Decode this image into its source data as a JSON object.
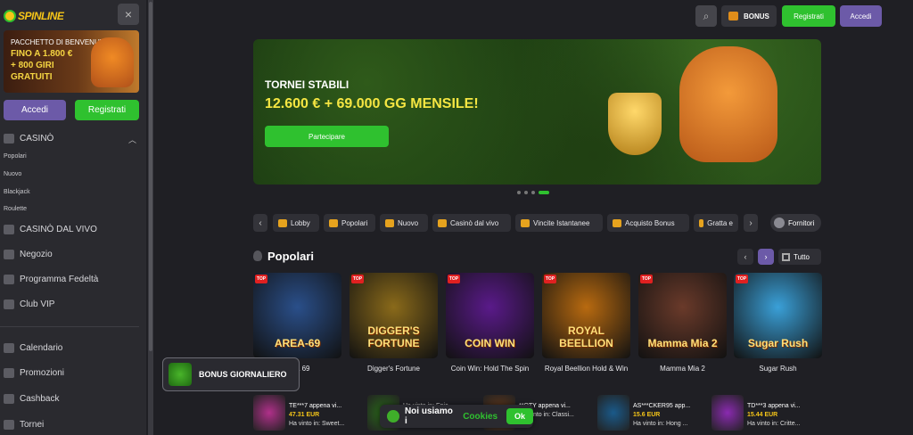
{
  "sidebar": {
    "logo_text": "SPINLINE",
    "close_icon": "×",
    "promo": {
      "line1": "PACCHETTO DI BENVENUTO",
      "line2": "FINO A 1.800 €",
      "line3": "+ 800 GIRI",
      "line4": "GRATUITI"
    },
    "accedi_label": "Accedi",
    "registrati_label": "Registrati",
    "casino_label": "CASINÒ",
    "casino_sub": [
      "Popolari",
      "Nuovo",
      "Blackjack",
      "Roulette"
    ],
    "menu": [
      "CASINÒ DAL VIVO",
      "Negozio",
      "Programma Fedeltà",
      "Club VIP"
    ],
    "menu2": [
      "Calendario",
      "Promozioni",
      "Cashback",
      "Tornei"
    ]
  },
  "topbar": {
    "search_icon": "search-icon",
    "bonus_label": "BONUS",
    "registrati_label": "Registrati",
    "accedi_label": "Accedi"
  },
  "banner": {
    "title": "TORNEI STABILI",
    "subtitle": "12.600 € + 69.000 GG MENSILE!",
    "button": "Partecipare"
  },
  "categories": [
    "Lobby",
    "Popolari",
    "Nuovo",
    "Casinò dal vivo",
    "Vincite Istantanee",
    "Acquisto Bonus",
    "Gratta e"
  ],
  "fornitori_label": "Fornitori",
  "section": {
    "title": "Popolari",
    "tutto_label": "Tutto"
  },
  "games": [
    {
      "name": "Area 69",
      "art": "AREA-69",
      "badge": "TOP",
      "color": "#2a4f8a"
    },
    {
      "name": "Digger's Fortune",
      "art": "DIGGER'S FORTUNE",
      "badge": "TOP",
      "color": "#8a6a1a"
    },
    {
      "name": "Coin Win: Hold The Spin",
      "art": "COIN WIN",
      "badge": "TOP",
      "color": "#5a1a8a"
    },
    {
      "name": "Royal Beellion Hold & Win",
      "art": "ROYAL BEELLION",
      "badge": "TOP",
      "color": "#b86a10"
    },
    {
      "name": "Mamma Mia 2",
      "art": "Mamma Mia 2",
      "badge": "TOP",
      "color": "#6a3a2a"
    },
    {
      "name": "Sugar Rush",
      "art": "Sugar Rush",
      "badge": "TOP",
      "color": "#3aa0d8"
    }
  ],
  "daily_bonus": "BONUS GIORNALIERO",
  "winners": [
    {
      "user": "TE***7 appena vi...",
      "amount": "47.31 EUR",
      "game": "Ha vinto in: Sweet...",
      "color": "#b0308a"
    },
    {
      "user": "",
      "amount": "",
      "game": "Ha vinto in: Epic...",
      "color": "#2a6a1a"
    },
    {
      "user": "**OTY appena vi...",
      "amount": "",
      "game": "Ha vinto in: Classi...",
      "color": "#6a3a1a"
    },
    {
      "user": "AS***CKER95 app...",
      "amount": "15.6 EUR",
      "game": "Ha vinto in: Hong ...",
      "color": "#1a5a8a"
    },
    {
      "user": "TD***3 appena vi...",
      "amount": "15.44 EUR",
      "game": "Ha vinto in: Critte...",
      "color": "#8a2ab0"
    }
  ],
  "cookie": {
    "text": "Noi usiamo i",
    "link": "Cookies",
    "ok": "Ok"
  }
}
